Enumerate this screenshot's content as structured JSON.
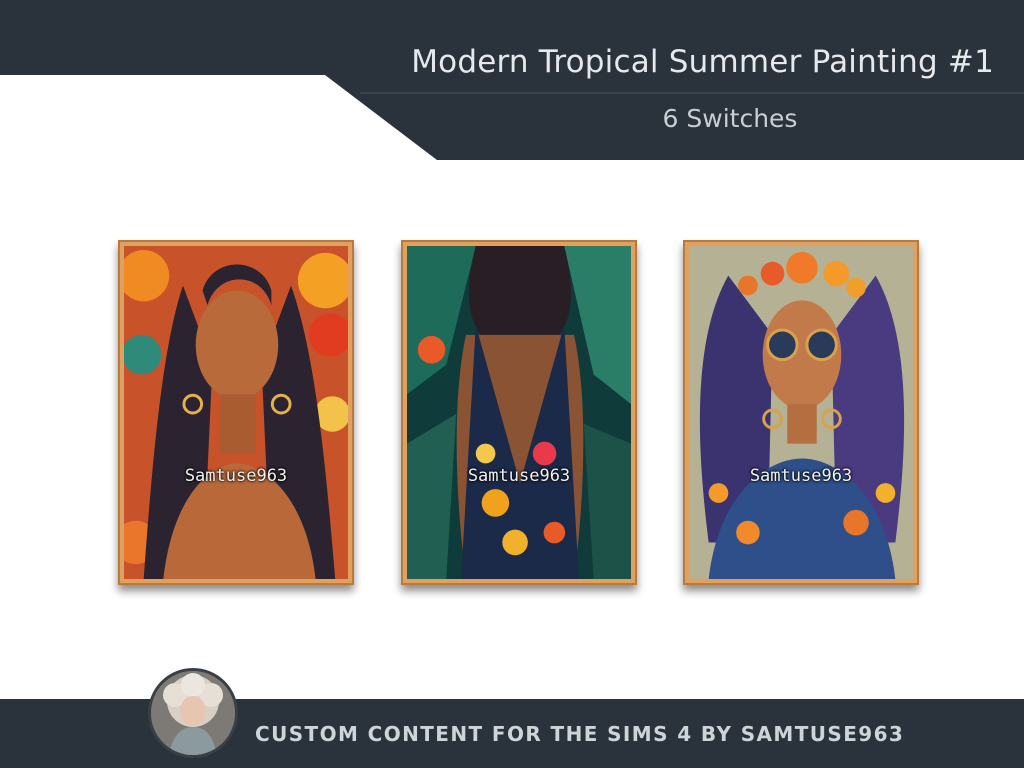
{
  "header": {
    "title": "Modern Tropical Summer Painting #1",
    "subtitle": "6 Switches"
  },
  "paintings": [
    {
      "watermark": "Samtuse963"
    },
    {
      "watermark": "Samtuse963"
    },
    {
      "watermark": "Samtuse963"
    }
  ],
  "footer": {
    "text": "CUSTOM CONTENT FOR THE SIMS 4 BY SAMTUSE963"
  },
  "colors": {
    "band": "#2a323c",
    "frame": "#e0a060",
    "background": "#ffffff"
  }
}
